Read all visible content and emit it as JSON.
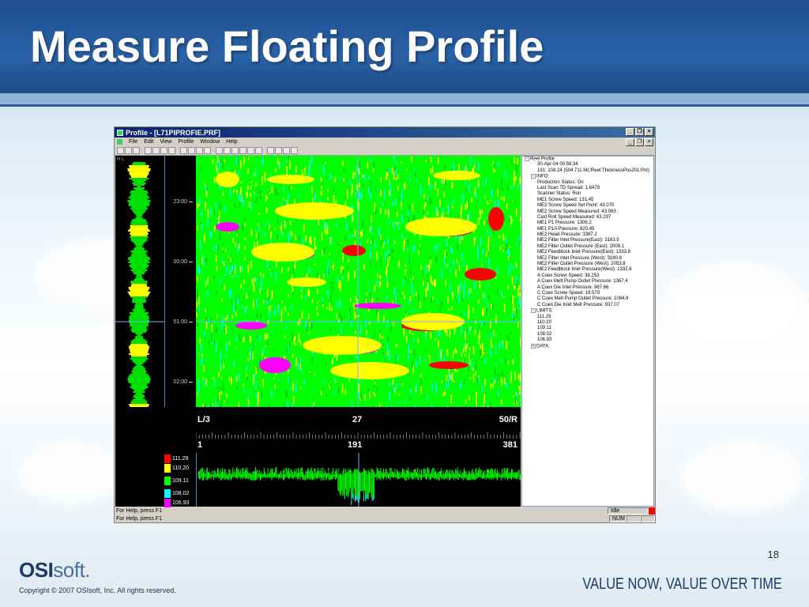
{
  "slide": {
    "title": "Measure Floating Profile",
    "page_number": "18",
    "logo_main": "OSI",
    "logo_soft": "soft",
    "logo_mark": ".",
    "copyright": "Copyright © 2007 OSIsoft, Inc. All rights reserved.",
    "tagline": "VALUE NOW, VALUE OVER TIME"
  },
  "app": {
    "window_title": "Profile - [L71PIPROFIE.PRF]",
    "menu": [
      "File",
      "Edit",
      "View",
      "Profile",
      "Window",
      "Help"
    ],
    "toolbar_icons": [
      "new-icon",
      "open-icon",
      "print-icon",
      "save-icon",
      "cut-icon",
      "copy-icon",
      "paste-icon",
      "undo-icon",
      "zoom-icon",
      "graph-icon",
      "table-icon",
      "run-icon",
      "stop-icon",
      "zoom-in-icon",
      "zoom-out-icon",
      "fit-icon",
      "color-icon",
      "arrow-icon",
      "crosshair-icon",
      "help-icon",
      "whats-this-icon"
    ],
    "hl_label": "H            L",
    "time_labels": [
      "23:00",
      "00:00",
      "01:00",
      "02:00"
    ],
    "axis_top": {
      "left": "L/3",
      "center": "27",
      "right": "50/R"
    },
    "axis_bottom": {
      "left": "1",
      "center": "191",
      "right": "381"
    },
    "legend": [
      {
        "value": "111.29",
        "color": "#ff0000"
      },
      {
        "value": "110.20",
        "color": "#ffff00"
      },
      {
        "value": "109.11",
        "color": "#00ff00"
      },
      {
        "value": "108.02",
        "color": "#00ffff"
      },
      {
        "value": "106.93",
        "color": "#ff00ff"
      }
    ],
    "tree": {
      "root": "Reel Profile",
      "timestamp": "30-Apr-04 00:58:34",
      "tag": "191: 108.24    (504.711 Mc:Reel:ThicknessPos201:Pnt)",
      "info_label": "INFO:",
      "info": [
        "Production Status: On",
        "Last Scan TD Spread: 1.6479",
        "Scanner Status: Run",
        "ME1 Screw Speed: 131.45",
        "ME2 Screw Speed Set Point: 43.070",
        "ME2 Screw Speed Measured: 43.083",
        "Cast Roll Speed Measured: 63.297",
        "ME1 P1 Pressure: 1306.2",
        "ME1 P1A Pressure: 820.45",
        "ME2 Head Pressure: 3387.2",
        "ME2 Filter Inlet Pressure(East): 3163.5",
        "ME2 Filter Outlet Pressure (East): 2008.1",
        "ME2 Feedblock Inlet Pressure(East): 1333.8",
        "ME2 Filter Inlet Pressure (West): 3180.8",
        "ME2 Filter Outlet Pressure (West): 2053.8",
        "ME2 Feedblock Inlet Pressure(West): 1332.6",
        "A Coex Screw Speed: 38.253",
        "A Coex Melt Pump Outlet Pressure: 1367.4",
        "A Coex Die Inlet Pressure: 967.66",
        "C Coex Screw Speed: 19.579",
        "C Coex Melt Pump Outlet Pressure: 1084.9",
        "C Coex Die Inlet Melt Pressure: 937.07"
      ],
      "limits_label": "LIMITS:",
      "limits": [
        "111.29",
        "110.20",
        "109.11",
        "108.02",
        "106.93"
      ],
      "data_label": "DATA:"
    },
    "status": {
      "help1": "For Help, press F1",
      "help2": "For Help, press F1",
      "state": "Idle",
      "num": "NUM"
    }
  }
}
